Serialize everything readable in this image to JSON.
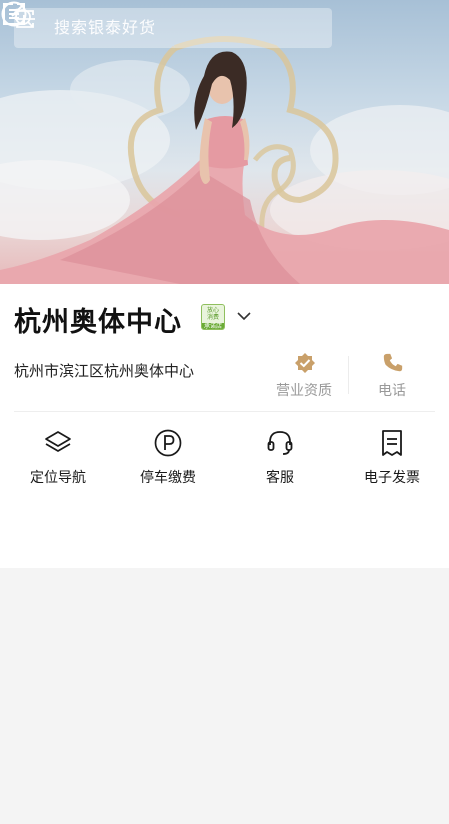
{
  "search": {
    "placeholder": "搜索银泰好货"
  },
  "header_icons": [
    "search-icon",
    "scan-icon",
    "share-icon",
    "menu-icon"
  ],
  "mall": {
    "name": "杭州奥体中心",
    "badge_lines": [
      "放心",
      "消费",
      "承诺店"
    ],
    "address": "杭州市滨江区杭州奥体中心"
  },
  "actions": [
    {
      "label": "营业资质",
      "icon": "verified-badge-icon",
      "color": "#c9a06a"
    },
    {
      "label": "电话",
      "icon": "phone-icon",
      "color": "#c9a06a"
    }
  ],
  "services": [
    {
      "label": "定位导航",
      "icon": "layers-icon"
    },
    {
      "label": "停车缴费",
      "icon": "parking-icon"
    },
    {
      "label": "客服",
      "icon": "headset-icon"
    },
    {
      "label": "电子发票",
      "icon": "invoice-icon"
    }
  ],
  "colors": {
    "accent": "#c9a06a",
    "badge_green": "#6aab35",
    "page_bg": "#f4f4f4"
  }
}
